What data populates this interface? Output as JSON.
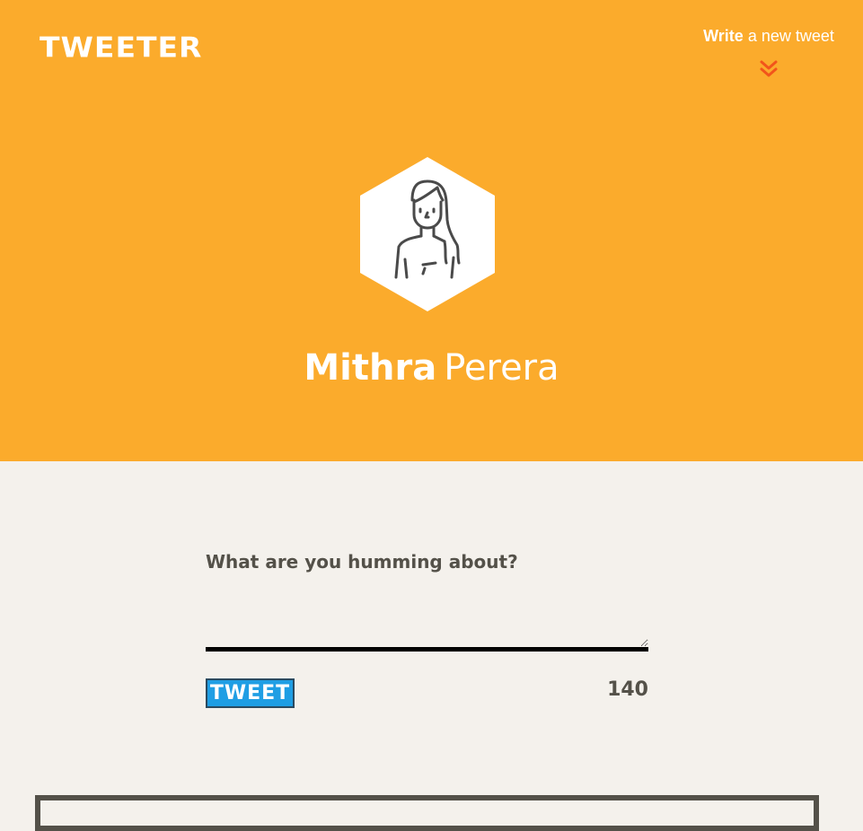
{
  "header": {
    "logo": "TWEETER",
    "write_link": {
      "strong": "Write",
      "rest": "a new tweet"
    },
    "chevron_icon": "double-chevron-down-icon",
    "colors": {
      "background": "#fbab2c",
      "text": "#ffffff",
      "chevron": "#f2541b"
    }
  },
  "profile": {
    "avatar_icon": "woman-avatar-icon",
    "first_name": "Mithra",
    "last_name": "Perera"
  },
  "compose": {
    "label": "What are you humming about?",
    "text_value": "",
    "button_label": "TWEET",
    "char_counter": "140",
    "colors": {
      "button": "#1f9ee4",
      "label": "#545149"
    }
  },
  "page": {
    "background": "#f4f1ec"
  }
}
